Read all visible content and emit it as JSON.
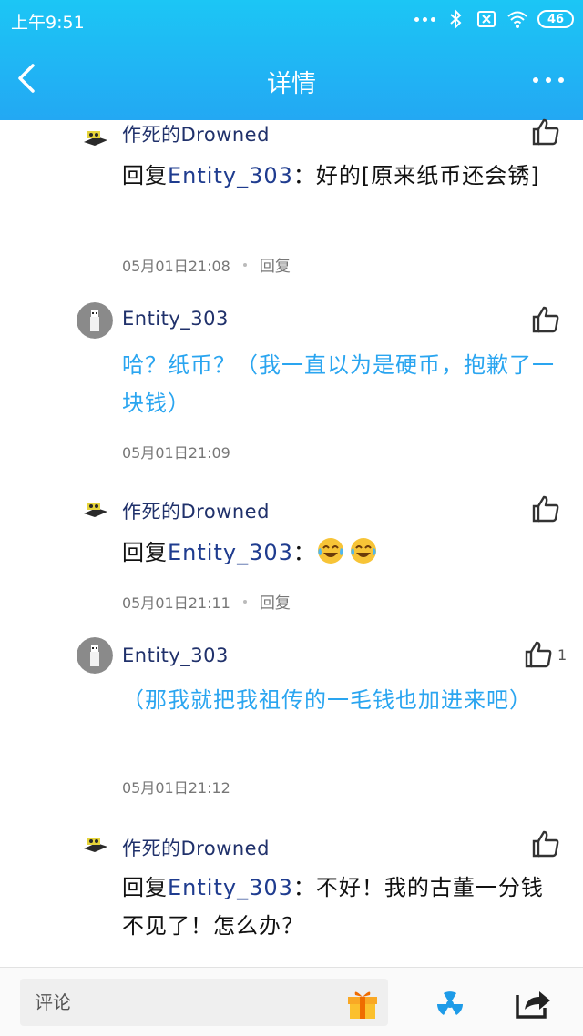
{
  "status_bar": {
    "time": "上午9:51",
    "battery": "46"
  },
  "nav": {
    "title": "详情"
  },
  "comments": [
    {
      "username": "作死的Drowned",
      "reply_prefix": "回复",
      "reply_to": "Entity_303",
      "text": "：好的[原来纸币还会锈]",
      "date": "05月01日21:08",
      "reply_label": "回复"
    },
    {
      "username": "Entity_303",
      "text": "哈？纸币？（我一直以为是硬币，抱歉了一块钱）",
      "date": "05月01日21:09"
    },
    {
      "username": "作死的Drowned",
      "reply_prefix": "回复",
      "reply_to": "Entity_303",
      "text": "：",
      "emoji_names": [
        "tears-of-joy-emoji",
        "tears-of-joy-emoji"
      ],
      "date": "05月01日21:11",
      "reply_label": "回复"
    },
    {
      "username": "Entity_303",
      "text": "（那我就把我祖传的一毛钱也加进来吧）",
      "date": "05月01日21:12",
      "like_count": "1"
    },
    {
      "username": "作死的Drowned",
      "reply_prefix": "回复",
      "reply_to": "Entity_303",
      "text": "：不好！我的古董一分钱不见了！怎么办？"
    }
  ],
  "bottom_bar": {
    "comment_placeholder": "评论"
  },
  "icons": {
    "back": "back-arrow-icon",
    "more": "more-dots-icon",
    "like": "thumbs-up-icon",
    "gift": "gift-icon",
    "radiation": "radiation-icon",
    "share": "share-icon"
  },
  "colors": {
    "header_top": "#1cc6f5",
    "header_bottom": "#23a8f3",
    "username": "#20316b",
    "highlight_text": "#2aa5f0"
  }
}
